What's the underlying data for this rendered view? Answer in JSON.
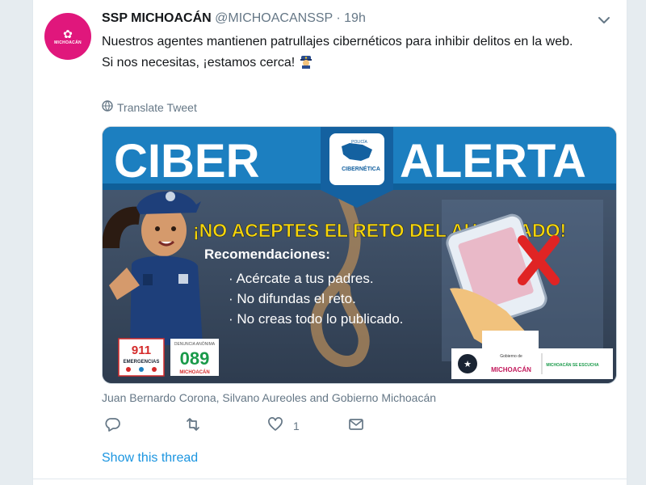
{
  "tweet": {
    "display_name": "SSP MICHOACÁN",
    "handle": "@MICHOACANSSP",
    "separator": "·",
    "time": "19h",
    "avatar_text": "MICHOACÁN",
    "text_line1": "Nuestros agentes mantienen patrullajes cibernéticos para inhibir delitos en la web.",
    "text_line2": "Si nos necesitas, ¡estamos cerca!",
    "translate_label": "Translate Tweet",
    "likers": "Juan Bernardo Corona, Silvano Aureoles and Gobierno Michoacán",
    "like_count": "1",
    "show_thread": "Show this thread"
  },
  "media": {
    "banner_left": "CIBER",
    "banner_right": "ALERTA",
    "badge_small": "POLICÍA",
    "badge_main": "CIBERNÉTICA",
    "headline": "¡NO ACEPTES EL RETO DEL AHORCADO!",
    "recommendations_title": "Recomendaciones:",
    "recommendations": [
      "· Acércate a tus padres.",
      "· No difundas el reto.",
      "· No creas todo lo publicado."
    ],
    "hotline_911": "911",
    "hotline_911_label": "EMERGENCIAS",
    "hotline_089": "089",
    "hotline_089_top": "DENUNCIA ANÓNIMA",
    "hotline_089_bottom": "MICHOACÁN",
    "logo_gobierno": "MICHOACÁN",
    "logo_gobierno_top": "Gobierno de",
    "logo_escucha": "MICHOACÁN SE ESCUCHA"
  },
  "icons": {
    "caret": "chevron-down-icon",
    "globe": "globe-icon",
    "reply": "reply-icon",
    "retweet": "retweet-icon",
    "like": "heart-icon",
    "dm": "envelope-icon"
  },
  "colors": {
    "accent": "#1b95e0",
    "avatar_bg": "#e0177c",
    "banner_blue": "#1c7fc0",
    "headline_yellow": "#f6d50a"
  }
}
